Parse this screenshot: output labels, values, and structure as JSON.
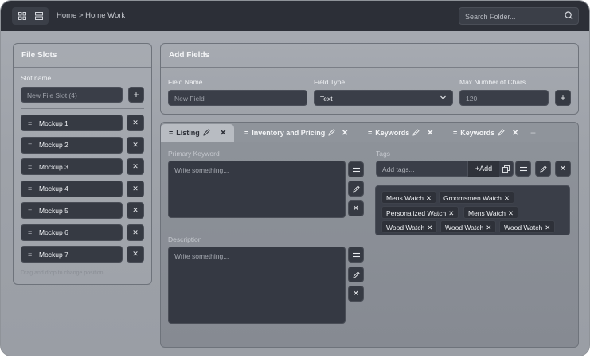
{
  "topbar": {
    "breadcrumb": "Home > Home Work",
    "search_placeholder": "Search Folder..."
  },
  "file_slots": {
    "title": "File Slots",
    "slot_name_label": "Slot name",
    "slot_name_placeholder": "New File Slot (4)",
    "add_symbol": "+",
    "items": [
      "Mockup 1",
      "Mockup 2",
      "Mockup 3",
      "Mockup 4",
      "Mockup 5",
      "Mockup 6",
      "Mockup 7"
    ],
    "hint": "Drag and drop to change position."
  },
  "add_fields": {
    "title": "Add Fields",
    "field_name_label": "Field Name",
    "field_name_placeholder": "New Field",
    "field_type_label": "Field Type",
    "field_type_value": "Text",
    "max_chars_label": "Max Number of Chars",
    "max_chars_value": "120",
    "add_symbol": "+"
  },
  "tabs": [
    {
      "label": "Listing",
      "active": true
    },
    {
      "label": "Inventory and Pricing",
      "active": false
    },
    {
      "label": "Keywords",
      "active": false
    },
    {
      "label": "Keywords",
      "active": false
    }
  ],
  "tab_add_symbol": "+",
  "editor": {
    "primary_keyword_label": "Primary Keyword",
    "primary_keyword_placeholder": "Write something...",
    "description_label": "Description",
    "description_placeholder": "Write something...",
    "tags_label": "Tags",
    "tags_placeholder": "Add tags...",
    "add_button": "+Add",
    "tags": [
      [
        "Mens Watch",
        "Groomsmen Watch"
      ],
      [
        "Personalized Watch",
        "Mens Watch"
      ],
      [
        "Wood Watch",
        "Wood Watch",
        "Wood Watch"
      ]
    ]
  }
}
